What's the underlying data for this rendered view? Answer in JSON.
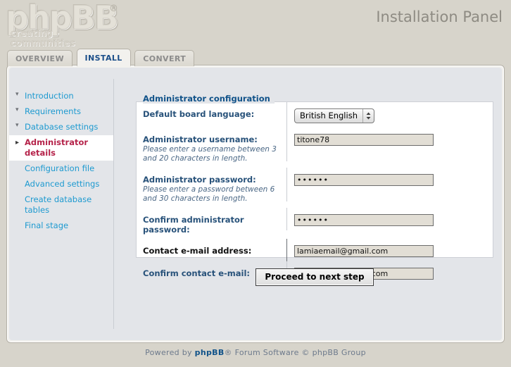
{
  "header": {
    "logo_main": "phpBB",
    "logo_reg": "®",
    "logo_tagline": "creating · communities",
    "panel_title": "Installation Panel"
  },
  "tabs": [
    {
      "label": "OVERVIEW",
      "active": false
    },
    {
      "label": "INSTALL",
      "active": true
    },
    {
      "label": "CONVERT",
      "active": false
    }
  ],
  "sidebar": {
    "items": [
      {
        "label": "Introduction",
        "state": "done"
      },
      {
        "label": "Requirements",
        "state": "done"
      },
      {
        "label": "Database settings",
        "state": "done"
      },
      {
        "label": "Administrator details",
        "state": "active"
      },
      {
        "label": "Configuration file",
        "state": "plain"
      },
      {
        "label": "Advanced settings",
        "state": "plain"
      },
      {
        "label": "Create database tables",
        "state": "plain"
      },
      {
        "label": "Final stage",
        "state": "plain"
      }
    ]
  },
  "main": {
    "section_heading": "Administrator configuration",
    "fields": {
      "language": {
        "label": "Default board language:",
        "value": "British English",
        "options": [
          "British English"
        ]
      },
      "username": {
        "label": "Administrator username:",
        "description": "Please enter a username between 3 and 20 characters in length.",
        "value": "titone78",
        "placeholder": ""
      },
      "password": {
        "label": "Administrator password:",
        "description": "Please enter a password between 6 and 30 characters in length.",
        "value": "••••••",
        "placeholder": ""
      },
      "confirm_password": {
        "label": "Confirm administrator password:",
        "value": "••••••",
        "placeholder": ""
      },
      "email": {
        "label": "Contact e-mail address:",
        "value": "lamiaemail@gmail.com",
        "placeholder": ""
      },
      "confirm_email": {
        "label": "Confirm contact e-mail:",
        "value": "lamiaemail@gmail.com",
        "placeholder": ""
      }
    },
    "submit_label": "Proceed to next step"
  },
  "footer": {
    "prefix": "Powered by ",
    "brand": "phpBB",
    "suffix": "® Forum Software © phpBB Group"
  },
  "colors": {
    "page_bg": "#d7d4cb",
    "panel_bg": "#e3e5e9",
    "accent_blue": "#105289",
    "link_blue": "#1e9ad0",
    "active_red": "#b5234a",
    "input_bg": "#e2ded5"
  }
}
